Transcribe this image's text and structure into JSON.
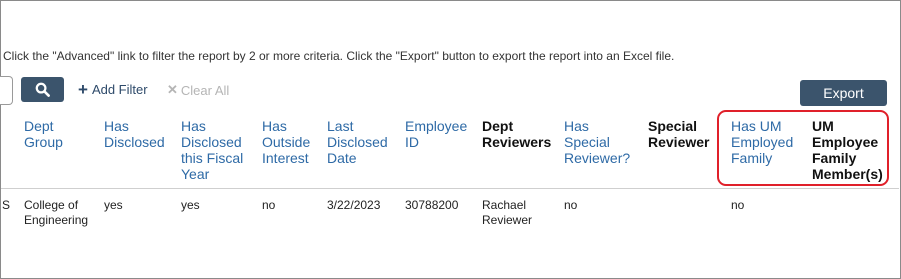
{
  "instructions": "Click the \"Advanced\" link to filter the report by 2 or more criteria. Click the \"Export\" button to export the report into an Excel file.",
  "toolbar": {
    "search_icon": "search-icon",
    "add_filter_label": "Add Filter",
    "clear_all_label": "Clear All",
    "export_label": "Export"
  },
  "table": {
    "columns": [
      {
        "key": "dept_group",
        "label": "Dept Group",
        "lines": [
          "Dept",
          "Group"
        ],
        "sortable": true
      },
      {
        "key": "has_disclosed",
        "label": "Has Disclosed",
        "lines": [
          "Has",
          "Disclosed"
        ],
        "sortable": true
      },
      {
        "key": "has_disclosed_fy",
        "label": "Has Disclosed this Fiscal Year",
        "lines": [
          "Has",
          "Disclosed",
          "this Fiscal",
          "Year"
        ],
        "sortable": true
      },
      {
        "key": "has_outside_interest",
        "label": "Has Outside Interest",
        "lines": [
          "Has",
          "Outside",
          "Interest"
        ],
        "sortable": true
      },
      {
        "key": "last_disclosed_date",
        "label": "Last Disclosed Date",
        "lines": [
          "Last",
          "Disclosed",
          "Date"
        ],
        "sortable": true
      },
      {
        "key": "employee_id",
        "label": "Employee ID",
        "lines": [
          "Employee",
          "ID"
        ],
        "sortable": true
      },
      {
        "key": "dept_reviewers",
        "label": "Dept Reviewers",
        "lines": [
          "Dept",
          "Reviewers"
        ],
        "sortable": false
      },
      {
        "key": "has_special_reviewer",
        "label": "Has Special Reviewer?",
        "lines": [
          "Has",
          "Special",
          "Reviewer?"
        ],
        "sortable": true
      },
      {
        "key": "special_reviewer",
        "label": "Special Reviewer",
        "lines": [
          "Special",
          "Reviewer"
        ],
        "sortable": false
      },
      {
        "key": "has_um_employed_family",
        "label": "Has UM Employed Family",
        "lines": [
          "Has UM",
          "Employed",
          "Family"
        ],
        "sortable": true
      },
      {
        "key": "um_employee_family_members",
        "label": "UM Employee Family Member(s)",
        "lines": [
          "UM",
          "Employee",
          "Family",
          "Member(s)"
        ],
        "sortable": false
      }
    ],
    "rows": [
      {
        "truncated_prefix": "S",
        "cells": [
          [
            "College of",
            "Engineering"
          ],
          [
            "yes"
          ],
          [
            "yes"
          ],
          [
            "no"
          ],
          [
            "3/22/2023"
          ],
          [
            "30788200"
          ],
          [
            "Rachael",
            "Reviewer"
          ],
          [
            "no"
          ],
          [
            ""
          ],
          [
            "no"
          ],
          [
            ""
          ]
        ]
      }
    ]
  },
  "colors": {
    "header_link": "#2e6aa6",
    "button_bg": "#3b546c",
    "highlight_border": "#e0202a"
  }
}
